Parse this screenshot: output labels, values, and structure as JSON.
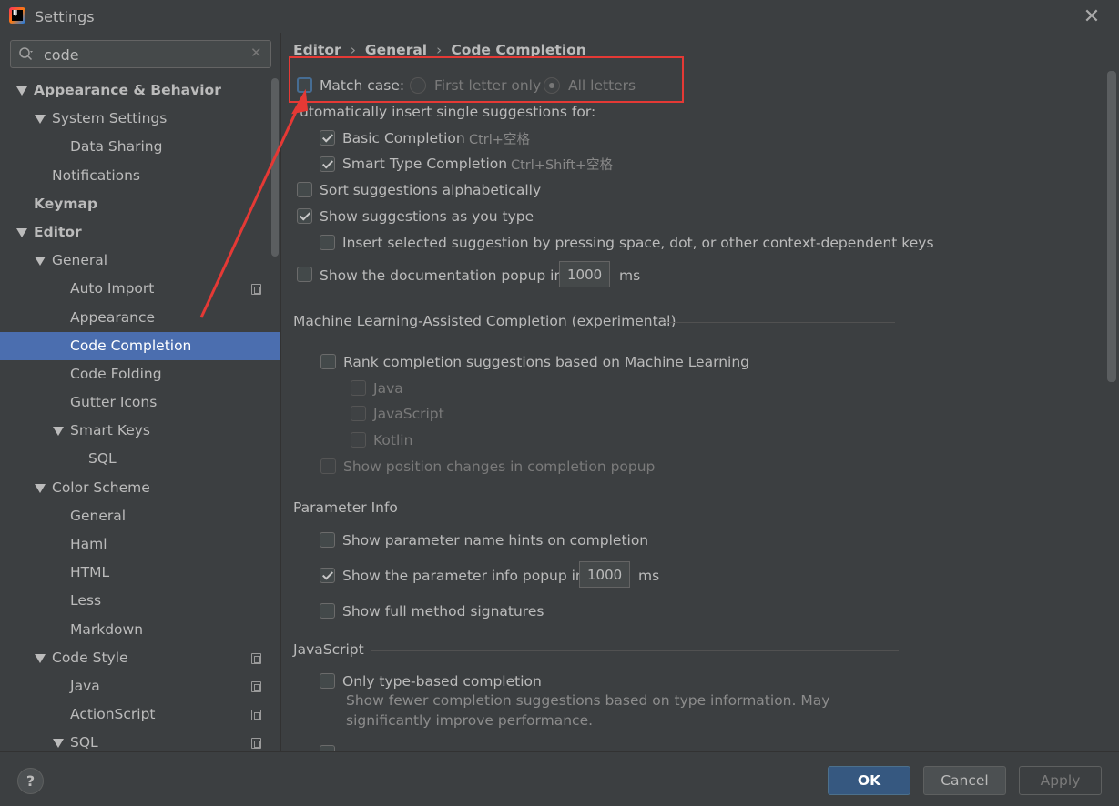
{
  "window": {
    "title": "Settings",
    "logo_text": "IJ",
    "close_glyph": "✕"
  },
  "sidebar": {
    "search_value": "code",
    "clear_glyph": "✕",
    "items": [
      {
        "label": "Appearance & Behavior",
        "level": 0,
        "expanded": true,
        "bold": true
      },
      {
        "label": "System Settings",
        "level": 1,
        "expanded": true
      },
      {
        "label": "Data Sharing",
        "level": 2
      },
      {
        "label": "Notifications",
        "level": 1
      },
      {
        "label": "Keymap",
        "level": 0,
        "bold": true
      },
      {
        "label": "Editor",
        "level": 0,
        "expanded": true,
        "bold": true
      },
      {
        "label": "General",
        "level": 1,
        "expanded": true
      },
      {
        "label": "Auto Import",
        "level": 2,
        "project_icon": true
      },
      {
        "label": "Appearance",
        "level": 2
      },
      {
        "label": "Code Completion",
        "level": 2,
        "selected": true
      },
      {
        "label": "Code Folding",
        "level": 2
      },
      {
        "label": "Gutter Icons",
        "level": 2
      },
      {
        "label": "Smart Keys",
        "level": 2,
        "expanded": true
      },
      {
        "label": "SQL",
        "level": 3
      },
      {
        "label": "Color Scheme",
        "level": 1,
        "expanded": true
      },
      {
        "label": "General",
        "level": 2
      },
      {
        "label": "Haml",
        "level": 2
      },
      {
        "label": "HTML",
        "level": 2
      },
      {
        "label": "Less",
        "level": 2
      },
      {
        "label": "Markdown",
        "level": 2
      },
      {
        "label": "Code Style",
        "level": 1,
        "expanded": true,
        "project_icon": true
      },
      {
        "label": "Java",
        "level": 2,
        "project_icon": true
      },
      {
        "label": "ActionScript",
        "level": 2,
        "project_icon": true
      },
      {
        "label": "SQL",
        "level": 2,
        "expanded": true,
        "project_icon": true
      }
    ]
  },
  "breadcrumb": {
    "part1": "Editor",
    "part2": "General",
    "part3": "Code Completion",
    "sep": "›"
  },
  "completion": {
    "match_case_label": "Match case:",
    "first_letter_label": "First letter only",
    "all_letters_label": "All letters",
    "auto_insert_label": "utomatically insert single suggestions for:",
    "basic_label": "Basic Completion",
    "basic_shortcut": "Ctrl+空格",
    "smart_label": "Smart Type Completion",
    "smart_shortcut": "Ctrl+Shift+空格",
    "sort_label": "Sort suggestions alphabetically",
    "show_as_type_label": "Show suggestions as you type",
    "insert_selected_label": "Insert selected suggestion by pressing space, dot, or other context-dependent keys",
    "doc_popup_label": "Show the documentation popup in",
    "doc_popup_value": "1000",
    "doc_popup_unit": "ms"
  },
  "ml": {
    "title": "Machine Learning-Assisted Completion (experimental)",
    "rank_label": "Rank completion suggestions based on Machine Learning",
    "java_label": "Java",
    "js_label": "JavaScript",
    "kotlin_label": "Kotlin",
    "position_label": "Show position changes in completion popup"
  },
  "param": {
    "title": "Parameter Info",
    "name_hints_label": "Show parameter name hints on completion",
    "info_popup_label": "Show the parameter info popup in",
    "info_popup_value": "1000",
    "info_popup_unit": "ms",
    "full_sig_label": "Show full method signatures"
  },
  "javascript": {
    "title": "JavaScript",
    "type_based_label": "Only type-based completion",
    "type_based_desc1": "Show fewer completion suggestions based on type information. May",
    "type_based_desc2": "significantly improve performance."
  },
  "footer": {
    "help_label": "?",
    "ok_label": "OK",
    "cancel_label": "Cancel",
    "apply_label": "Apply"
  },
  "colors": {
    "background": "#3c3f41",
    "selection": "#4b6eaf",
    "annotation_red": "#e53935",
    "ok_button": "#365880"
  }
}
